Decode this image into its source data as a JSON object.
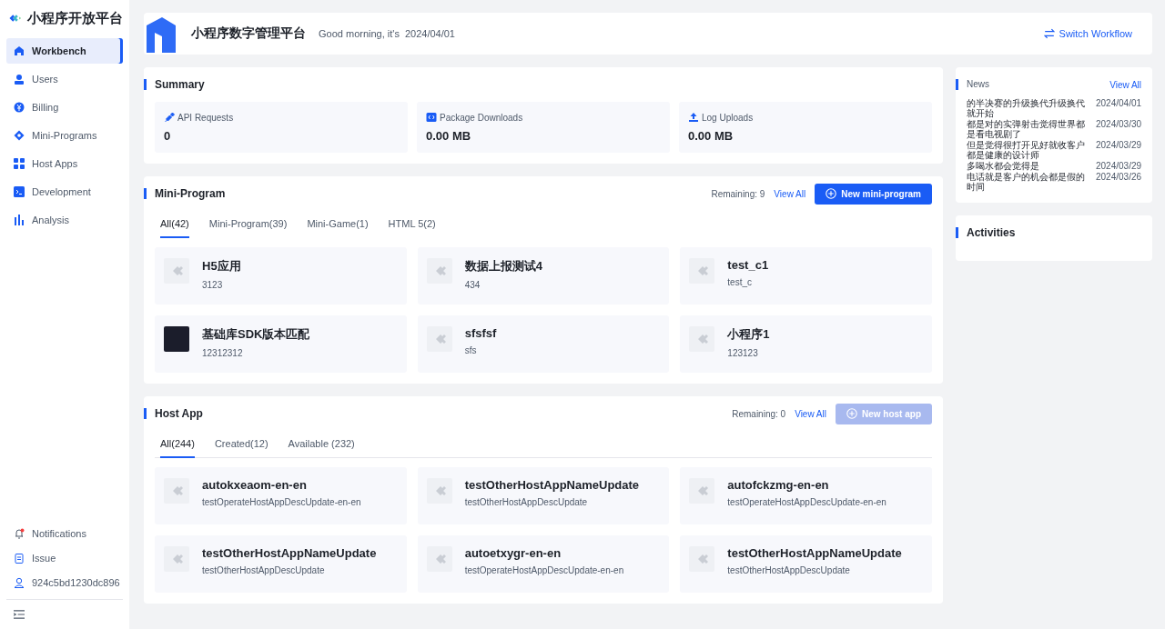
{
  "sidebar": {
    "brand": "小程序开放平台",
    "items": [
      {
        "label": "Workbench",
        "selected": true
      },
      {
        "label": "Users",
        "selected": false
      },
      {
        "label": "Billing",
        "selected": false
      },
      {
        "label": "Mini-Programs",
        "selected": false
      },
      {
        "label": "Host Apps",
        "selected": false
      },
      {
        "label": "Development",
        "selected": false
      },
      {
        "label": "Analysis",
        "selected": false
      }
    ],
    "footer_items": [
      {
        "label": "Notifications",
        "unread": true
      },
      {
        "label": "Issue",
        "unread": false
      },
      {
        "label": "924c5bd1230dc896",
        "unread": false
      }
    ]
  },
  "header": {
    "title": "小程序数字管理平台",
    "greeting": "Good morning, it's",
    "date": "2024/04/01",
    "action": "Switch Workflow"
  },
  "summary": {
    "title": "Summary",
    "stats": [
      {
        "label": "API Requests",
        "value": "0"
      },
      {
        "label": "Package Downloads",
        "value": "0.00 MB"
      },
      {
        "label": "Log Uploads",
        "value": "0.00 MB"
      }
    ]
  },
  "sections": [
    {
      "title": "Mini-Program",
      "remaining": "Remaining: 9",
      "view_all": "View All",
      "button": {
        "label": "New mini-program",
        "disabled": false
      },
      "tabs": [
        {
          "label": "All(42)",
          "selected": true
        },
        {
          "label": "Mini-Program(39)",
          "selected": false
        },
        {
          "label": "Mini-Game(1)",
          "selected": false
        },
        {
          "label": "HTML 5(2)",
          "selected": false
        }
      ],
      "cards": [
        {
          "name": "H5应用",
          "desc": "3123",
          "kind": "default"
        },
        {
          "name": "数据上报测试4",
          "desc": "434",
          "kind": "default"
        },
        {
          "name": "test_c1",
          "desc": "test_c",
          "kind": "default"
        },
        {
          "name": "基础库SDK版本匹配",
          "desc": "12312312",
          "kind": "image"
        },
        {
          "name": "sfsfsf",
          "desc": "sfs",
          "kind": "default"
        },
        {
          "name": "小程序1",
          "desc": "123123",
          "kind": "default"
        }
      ]
    },
    {
      "title": "Host App",
      "remaining": "Remaining: 0",
      "view_all": "View All",
      "button": {
        "label": "New host app",
        "disabled": true
      },
      "tabs": [
        {
          "label": "All(244)",
          "selected": true
        },
        {
          "label": "Created(12)",
          "selected": false
        },
        {
          "label": "Available (232)",
          "selected": false
        }
      ],
      "cards": [
        {
          "name": "autokxeaom-en-en",
          "desc": "testOperateHostAppDescUpdate-en-en",
          "kind": "default"
        },
        {
          "name": "testOtherHostAppNameUpdate",
          "desc": "testOtherHostAppDescUpdate",
          "kind": "default"
        },
        {
          "name": "autofckzmg-en-en",
          "desc": "testOperateHostAppDescUpdate-en-en",
          "kind": "default"
        },
        {
          "name": "testOtherHostAppNameUpdate",
          "desc": "testOtherHostAppDescUpdate",
          "kind": "default"
        },
        {
          "name": "autoetxygr-en-en",
          "desc": "testOperateHostAppDescUpdate-en-en",
          "kind": "default"
        },
        {
          "name": "testOtherHostAppNameUpdate",
          "desc": "testOtherHostAppDescUpdate",
          "kind": "default"
        }
      ]
    }
  ],
  "news": {
    "title": "News",
    "view_all": "View All",
    "items": [
      {
        "title": "的半决赛的升级换代升级换代就开始",
        "date": "2024/04/01"
      },
      {
        "title": "都是对的实弹射击觉得世界都是看电视剧了",
        "date": "2024/03/30"
      },
      {
        "title": "但是觉得很打开见好就收客户都是健康的设计师",
        "date": "2024/03/29"
      },
      {
        "title": "多喝水都会觉得是",
        "date": "2024/03/29"
      },
      {
        "title": "电话就是客户的机会都是假的时间",
        "date": "2024/03/26"
      }
    ]
  },
  "activities": {
    "title": "Activities"
  }
}
